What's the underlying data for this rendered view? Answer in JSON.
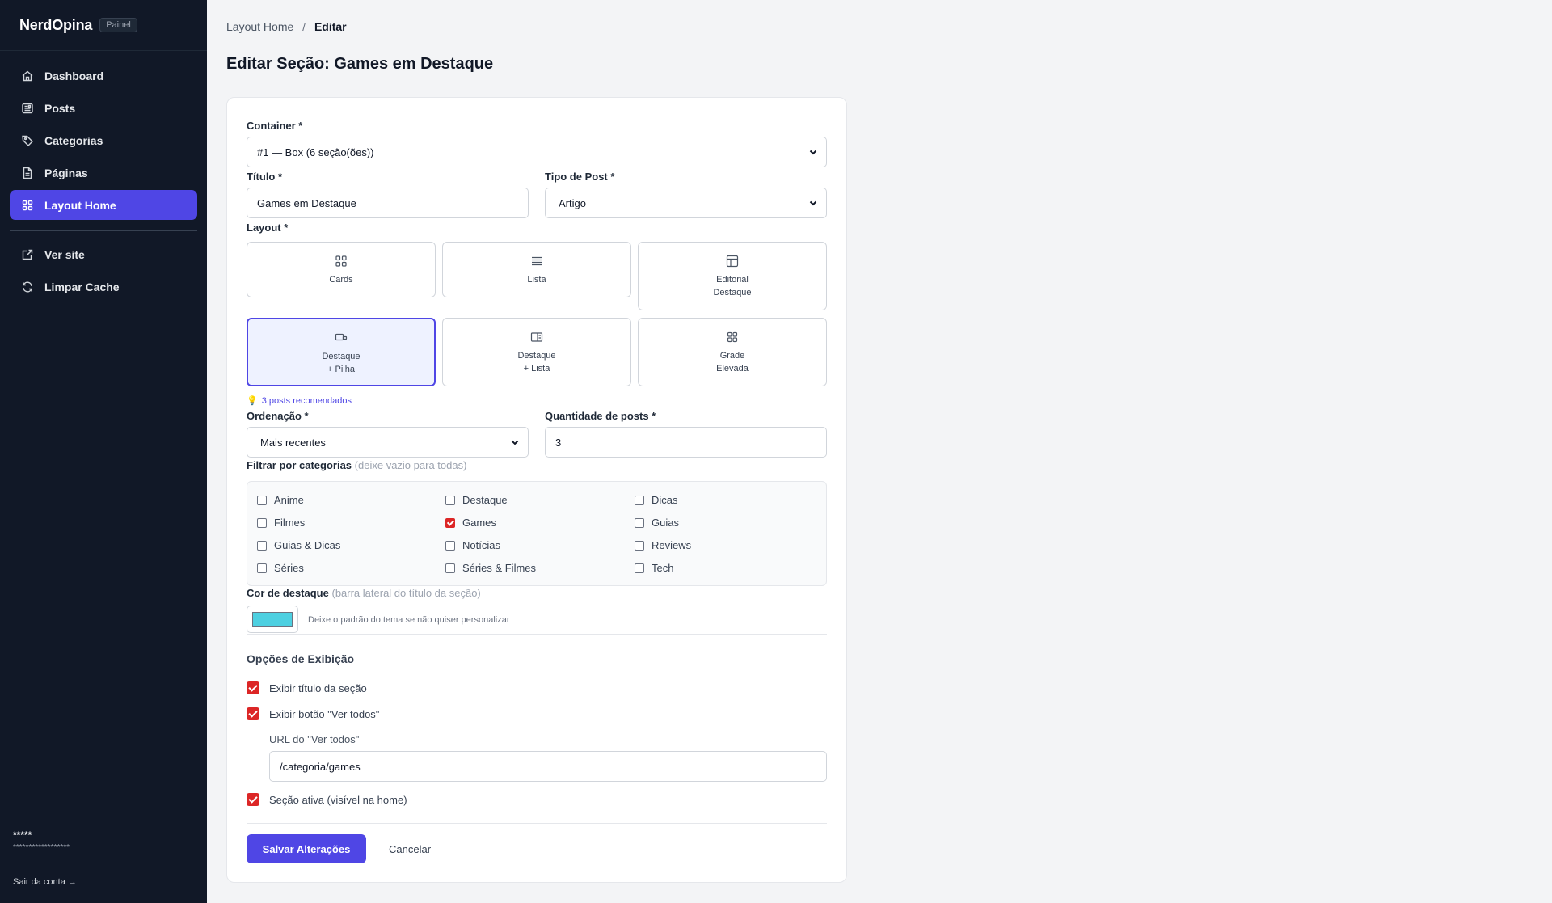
{
  "sidebar": {
    "brand": "NerdOpina",
    "badge": "Painel",
    "items": [
      {
        "label": "Dashboard",
        "icon": "home-icon"
      },
      {
        "label": "Posts",
        "icon": "newspaper-icon"
      },
      {
        "label": "Categorias",
        "icon": "tag-icon"
      },
      {
        "label": "Páginas",
        "icon": "document-icon"
      },
      {
        "label": "Layout Home",
        "icon": "grid-icon",
        "active": true
      }
    ],
    "secondary": [
      {
        "label": "Ver site",
        "icon": "external-link-icon"
      },
      {
        "label": "Limpar Cache",
        "icon": "refresh-icon"
      }
    ],
    "user_name": "*****",
    "user_email": "******************",
    "logout": "Sair da conta →"
  },
  "breadcrumb": {
    "parent": "Layout Home",
    "separator": "/",
    "current": "Editar"
  },
  "page_title": "Editar Seção: Games em Destaque",
  "form": {
    "container_label": "Container *",
    "container_value": "#1 — Box (6 seção(ões))",
    "titulo_label": "Título *",
    "titulo_value": "Games em Destaque",
    "tipo_label": "Tipo de Post *",
    "tipo_value": "Artigo",
    "layout_label": "Layout *",
    "layouts": [
      {
        "label": "Cards",
        "icon": "grid-icon"
      },
      {
        "label": "Lista",
        "icon": "list-icon"
      },
      {
        "label": "Editorial\nDestaque",
        "icon": "editorial-icon"
      },
      {
        "label": "Destaque\n+ Pilha",
        "icon": "stack-icon",
        "selected": true
      },
      {
        "label": "Destaque\n+ Lista",
        "icon": "feature-list-icon"
      },
      {
        "label": "Grade\nElevada",
        "icon": "grid-icon"
      }
    ],
    "recommended": "3 posts recomendados",
    "ordenacao_label": "Ordenação *",
    "ordenacao_value": "Mais recentes",
    "quantidade_label": "Quantidade de posts *",
    "quantidade_value": "3",
    "filtro_label": "Filtrar por categorias",
    "filtro_hint": "(deixe vazio para todas)",
    "categories": [
      {
        "label": "Anime",
        "checked": false
      },
      {
        "label": "Destaque",
        "checked": false
      },
      {
        "label": "Dicas",
        "checked": false
      },
      {
        "label": "Filmes",
        "checked": false
      },
      {
        "label": "Games",
        "checked": true
      },
      {
        "label": "Guias",
        "checked": false
      },
      {
        "label": "Guias & Dicas",
        "checked": false
      },
      {
        "label": "Notícias",
        "checked": false
      },
      {
        "label": "Reviews",
        "checked": false
      },
      {
        "label": "Séries",
        "checked": false
      },
      {
        "label": "Séries & Filmes",
        "checked": false
      },
      {
        "label": "Tech",
        "checked": false
      }
    ],
    "cor_label": "Cor de destaque",
    "cor_hint": "(barra lateral do título da seção)",
    "cor_value": "#4dd0e1",
    "cor_help": "Deixe o padrão do tema se não quiser personalizar",
    "opcoes_title": "Opções de Exibição",
    "opt_titulo": "Exibir título da seção",
    "opt_botao": "Exibir botão \"Ver todos\"",
    "url_label": "URL do \"Ver todos\"",
    "url_value": "/categoria/games",
    "opt_ativa": "Seção ativa (visível na home)",
    "save": "Salvar Alterações",
    "cancel": "Cancelar"
  },
  "colors": {
    "accent": "#4f46e5",
    "sidebar": "#111827",
    "checked": "#dc2626"
  }
}
